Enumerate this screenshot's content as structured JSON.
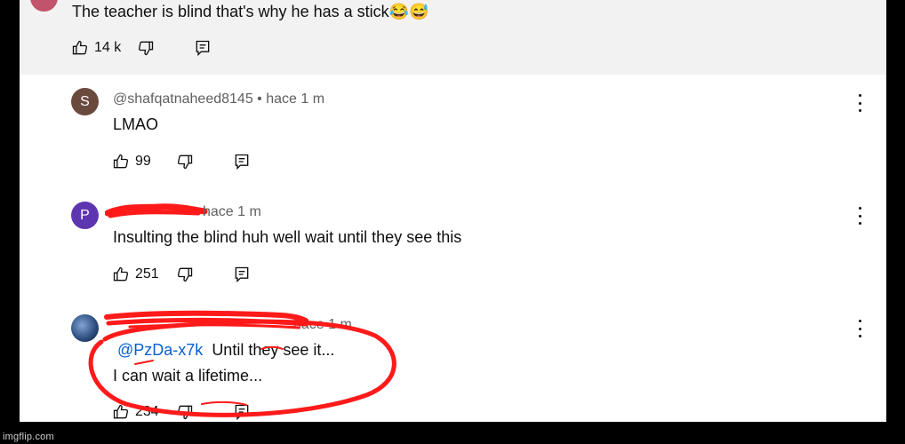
{
  "comments": [
    {
      "text": "The teacher is blind that's why he has a stick",
      "emojis": "😂😅",
      "likes": "14 k",
      "avatar_color": "#c2536d"
    },
    {
      "avatar_letter": "S",
      "avatar_color": "#6b4a3e",
      "handle": "@shafqatnaheed8145",
      "time": "• hace 1 m",
      "text": "LMAO",
      "likes": "99"
    },
    {
      "avatar_letter": "P",
      "avatar_color": "#5e35b1",
      "time": "hace 1 m",
      "text": "Insulting the blind huh well wait until they see this",
      "likes": "251"
    },
    {
      "avatar_color": "#2a4a7a",
      "time": "hace 1 m",
      "mention": "@PzDa-x7k",
      "text_line1": "Until they see it...",
      "text_line2": "I can wait a lifetime...",
      "likes": "234"
    }
  ],
  "annotation_color": "#ff1a1a",
  "watermark": "imgflip.com"
}
